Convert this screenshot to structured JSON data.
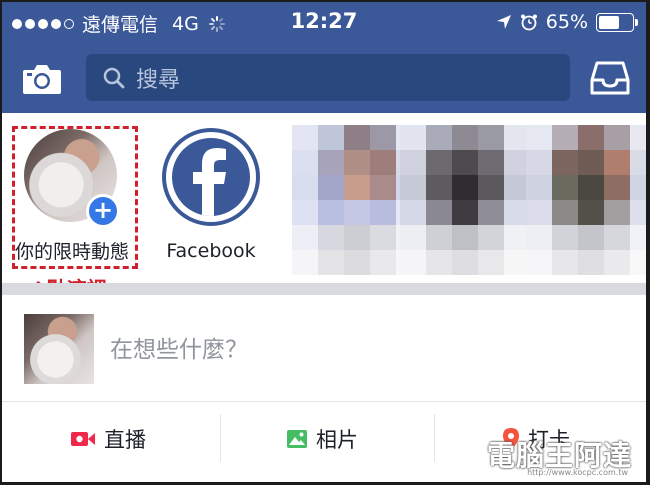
{
  "status_bar": {
    "carrier": "遠傳電信",
    "network": "4G",
    "time": "12:27",
    "battery": "65%",
    "battery_level": 0.65
  },
  "nav": {
    "search_placeholder": "搜尋"
  },
  "stories": {
    "mine_label": "你的限時動態",
    "facebook_label": "Facebook",
    "annotation": "↑點這裡"
  },
  "composer": {
    "prompt": "在想些什麼？"
  },
  "actions": {
    "live": "直播",
    "photo": "相片",
    "checkin": "打卡"
  },
  "watermark": {
    "name": "電腦王阿達",
    "url": "http://www.kocpc.com.tw"
  },
  "colors": {
    "brand": "#3b5998",
    "search_bg": "#29487d",
    "annotation_red": "#d21f2c",
    "live_red": "#f02849",
    "photo_green": "#45bd62",
    "checkin_pink": "#f5533d"
  }
}
